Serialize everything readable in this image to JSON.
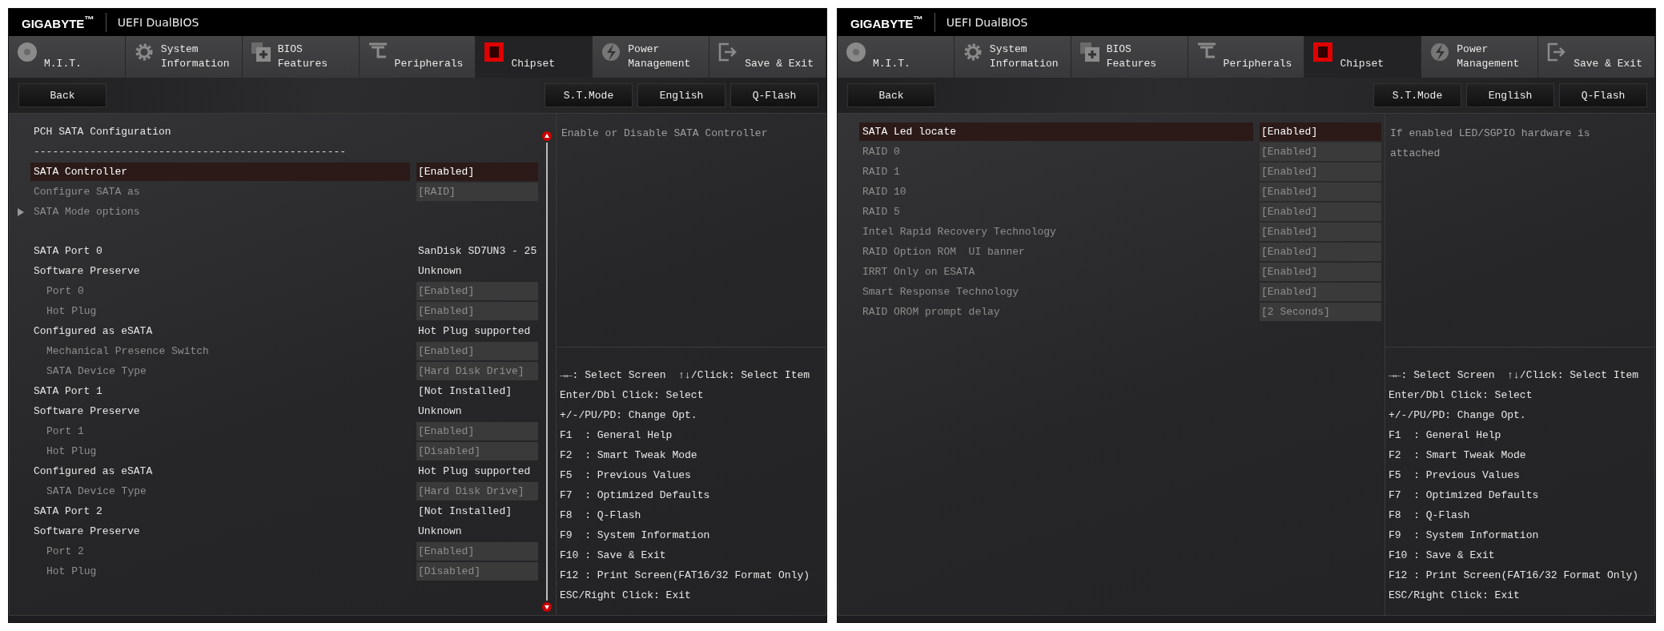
{
  "screens": [
    {
      "header": {
        "brand": "GIGABYTE$^{™}$",
        "title": "UEFI DualBIOS"
      },
      "tabs": [
        {
          "lines": [
            "M.I.T."
          ],
          "selected": false
        },
        {
          "lines": [
            "System",
            "Information"
          ],
          "selected": false
        },
        {
          "lines": [
            "BIOS",
            "Features"
          ],
          "selected": false
        },
        {
          "lines": [
            "Peripherals"
          ],
          "selected": false
        },
        {
          "lines": [
            "Chipset"
          ],
          "selected": true
        },
        {
          "lines": [
            "Power",
            "Management"
          ],
          "selected": false
        },
        {
          "lines": [
            "Save & Exit"
          ],
          "selected": false
        }
      ],
      "toolbar": {
        "back": "Back",
        "buttons": [
          "S.T.Mode",
          "English",
          "Q-Flash"
        ]
      },
      "scrollable": true,
      "settings": [
        {
          "kind": "heading",
          "label": "PCH SATA Configuration"
        },
        {
          "kind": "separator",
          "label": "--------------------------------------------------"
        },
        {
          "kind": "option",
          "label": "SATA Controller",
          "value": "[Enabled]",
          "selected": true,
          "disabled": false
        },
        {
          "kind": "option",
          "label": "Configure SATA as",
          "value": "[RAID]",
          "selected": false,
          "disabled": true
        },
        {
          "kind": "submenu",
          "label": "SATA Mode options",
          "selected": false,
          "disabled": true
        },
        {
          "kind": "info",
          "label": "SATA Port 0",
          "value": "SanDisk SD7UN3 - 25",
          "selected": false,
          "disabled": false,
          "spaced": true
        },
        {
          "kind": "info",
          "label": "Software Preserve",
          "value": "Unknown",
          "selected": false,
          "disabled": false,
          "children": [
            {
              "kind": "option",
              "label": "Port 0",
              "value": "[Enabled]",
              "selected": false,
              "disabled": true
            },
            {
              "kind": "option",
              "label": "Hot Plug",
              "value": "[Enabled]",
              "selected": false,
              "disabled": true
            }
          ]
        },
        {
          "kind": "info",
          "label": "Configured as eSATA",
          "value": "Hot Plug supported",
          "selected": false,
          "disabled": false,
          "children": [
            {
              "kind": "option",
              "label": "Mechanical Presence Switch",
              "value": "[Enabled]",
              "selected": false,
              "disabled": true
            },
            {
              "kind": "option",
              "label": "SATA Device Type",
              "value": "[Hard Disk Drive]",
              "selected": false,
              "disabled": true
            }
          ]
        },
        {
          "kind": "info",
          "label": "SATA Port 1",
          "value": "[Not Installed]",
          "selected": false,
          "disabled": false
        },
        {
          "kind": "info",
          "label": "Software Preserve",
          "value": "Unknown",
          "selected": false,
          "disabled": false,
          "children": [
            {
              "kind": "option",
              "label": "Port 1",
              "value": "[Enabled]",
              "selected": false,
              "disabled": true
            },
            {
              "kind": "option",
              "label": "Hot Plug",
              "value": "[Disabled]",
              "selected": false,
              "disabled": true
            }
          ]
        },
        {
          "kind": "info",
          "label": "Configured as eSATA",
          "value": "Hot Plug supported",
          "selected": false,
          "disabled": false,
          "children": [
            {
              "kind": "option",
              "label": "SATA Device Type",
              "value": "[Hard Disk Drive]",
              "selected": false,
              "disabled": true
            }
          ]
        },
        {
          "kind": "info",
          "label": "SATA Port 2",
          "value": "[Not Installed]",
          "selected": false,
          "disabled": false
        },
        {
          "kind": "info",
          "label": "Software Preserve",
          "value": "Unknown",
          "selected": false,
          "disabled": false,
          "children": [
            {
              "kind": "option",
              "label": "Port 2",
              "value": "[Enabled]",
              "selected": false,
              "disabled": true
            },
            {
              "kind": "option",
              "label": "Hot Plug",
              "value": "[Disabled]",
              "selected": false,
              "disabled": true
            }
          ]
        }
      ],
      "help_text": "Enable or Disable SATA Controller",
      "key_help": [
        "→←: Select Screen  ↑↓/Click: Select Item",
        "Enter/Dbl Click: Select",
        "+/-/PU/PD: Change Opt.",
        "F1  : General Help",
        "F2  : Smart Tweak Mode",
        "F5  : Previous Values",
        "F7  : Optimized Defaults",
        "F8  : Q-Flash",
        "F9  : System Information",
        "F10 : Save & Exit",
        "F12 : Print Screen(FAT16/32 Format Only)",
        "ESC/Right Click: Exit"
      ]
    },
    {
      "header": {
        "brand": "GIGABYTE$^{™}$",
        "title": "UEFI DualBIOS"
      },
      "tabs": [
        {
          "lines": [
            "M.I.T."
          ],
          "selected": false
        },
        {
          "lines": [
            "System",
            "Information"
          ],
          "selected": false
        },
        {
          "lines": [
            "BIOS",
            "Features"
          ],
          "selected": false
        },
        {
          "lines": [
            "Peripherals"
          ],
          "selected": false
        },
        {
          "lines": [
            "Chipset"
          ],
          "selected": true
        },
        {
          "lines": [
            "Power",
            "Management"
          ],
          "selected": false
        },
        {
          "lines": [
            "Save & Exit"
          ],
          "selected": false
        }
      ],
      "toolbar": {
        "back": "Back",
        "buttons": [
          "S.T.Mode",
          "English",
          "Q-Flash"
        ]
      },
      "scrollable": false,
      "settings": [
        {
          "kind": "option",
          "label": "SATA Led locate",
          "value": "[Enabled]",
          "selected": true,
          "disabled": false
        },
        {
          "kind": "option",
          "label": "RAID 0",
          "value": "[Enabled]",
          "selected": false,
          "disabled": true
        },
        {
          "kind": "option",
          "label": "RAID 1",
          "value": "[Enabled]",
          "selected": false,
          "disabled": true
        },
        {
          "kind": "option",
          "label": "RAID 10",
          "value": "[Enabled]",
          "selected": false,
          "disabled": true
        },
        {
          "kind": "option",
          "label": "RAID 5",
          "value": "[Enabled]",
          "selected": false,
          "disabled": true
        },
        {
          "kind": "option",
          "label": "Intel Rapid Recovery Technology",
          "value": "[Enabled]",
          "selected": false,
          "disabled": true
        },
        {
          "kind": "option",
          "label": "RAID Option ROM  UI banner",
          "value": "[Enabled]",
          "selected": false,
          "disabled": true
        },
        {
          "kind": "option",
          "label": "IRRT Only on ESATA",
          "value": "[Enabled]",
          "selected": false,
          "disabled": true
        },
        {
          "kind": "option",
          "label": "Smart Response Technology",
          "value": "[Enabled]",
          "selected": false,
          "disabled": true
        },
        {
          "kind": "option",
          "label": "RAID OROM prompt delay",
          "value": "[2 Seconds]",
          "selected": false,
          "disabled": true
        }
      ],
      "help_text": "If enabled LED/SGPIO hardware is attached",
      "key_help": [
        "→←: Select Screen  ↑↓/Click: Select Item",
        "Enter/Dbl Click: Select",
        "+/-/PU/PD: Change Opt.",
        "F1  : General Help",
        "F2  : Smart Tweak Mode",
        "F5  : Previous Values",
        "F7  : Optimized Defaults",
        "F8  : Q-Flash",
        "F9  : System Information",
        "F10 : Save & Exit",
        "F12 : Print Screen(FAT16/32 Format Only)",
        "ESC/Right Click: Exit"
      ]
    }
  ]
}
